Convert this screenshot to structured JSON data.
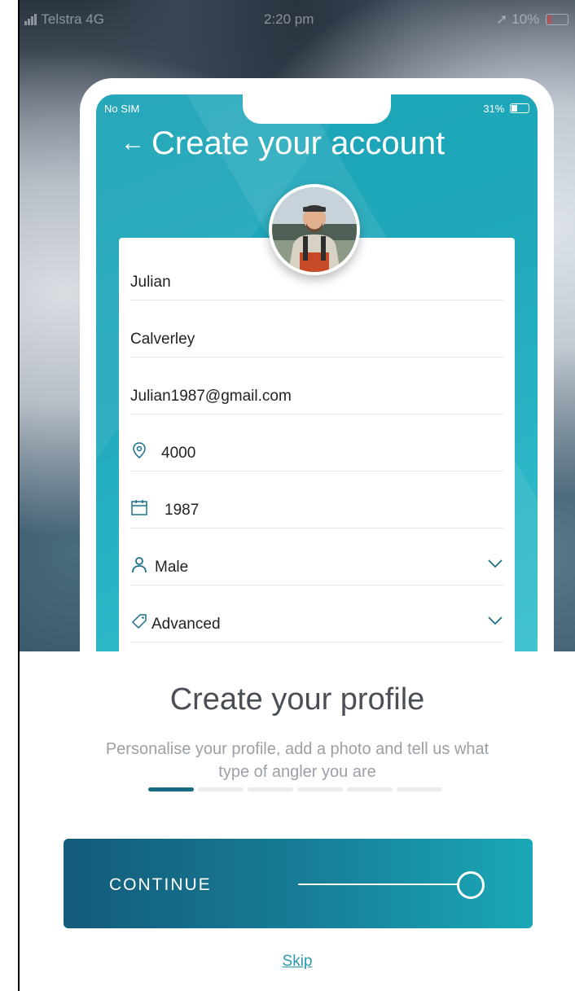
{
  "status_bar": {
    "carrier": "Telstra",
    "network": "4G",
    "time": "2:20 pm",
    "battery": "10%"
  },
  "mockup": {
    "status": {
      "left": "No SIM",
      "battery": "31%"
    },
    "title": "Create your account",
    "fields": [
      {
        "value": "Julian"
      },
      {
        "value": "Calverley"
      },
      {
        "value": "Julian1987@gmail.com"
      },
      {
        "value": "4000"
      },
      {
        "value": "1987"
      },
      {
        "value": "Male"
      },
      {
        "value": "Advanced"
      }
    ]
  },
  "onboarding": {
    "title": "Create your profile",
    "subtitle_line1": "Personalise your profile, add a photo and tell us what",
    "subtitle_line2": "type of angler you are",
    "progress_step": 1,
    "progress_total": 6
  },
  "cta": {
    "label": "CONTINUE"
  },
  "skip": {
    "label": "Skip"
  },
  "colors": {
    "accent": "#1aa3b6",
    "button_dark": "#135b7a",
    "link": "#2b9ab3"
  }
}
